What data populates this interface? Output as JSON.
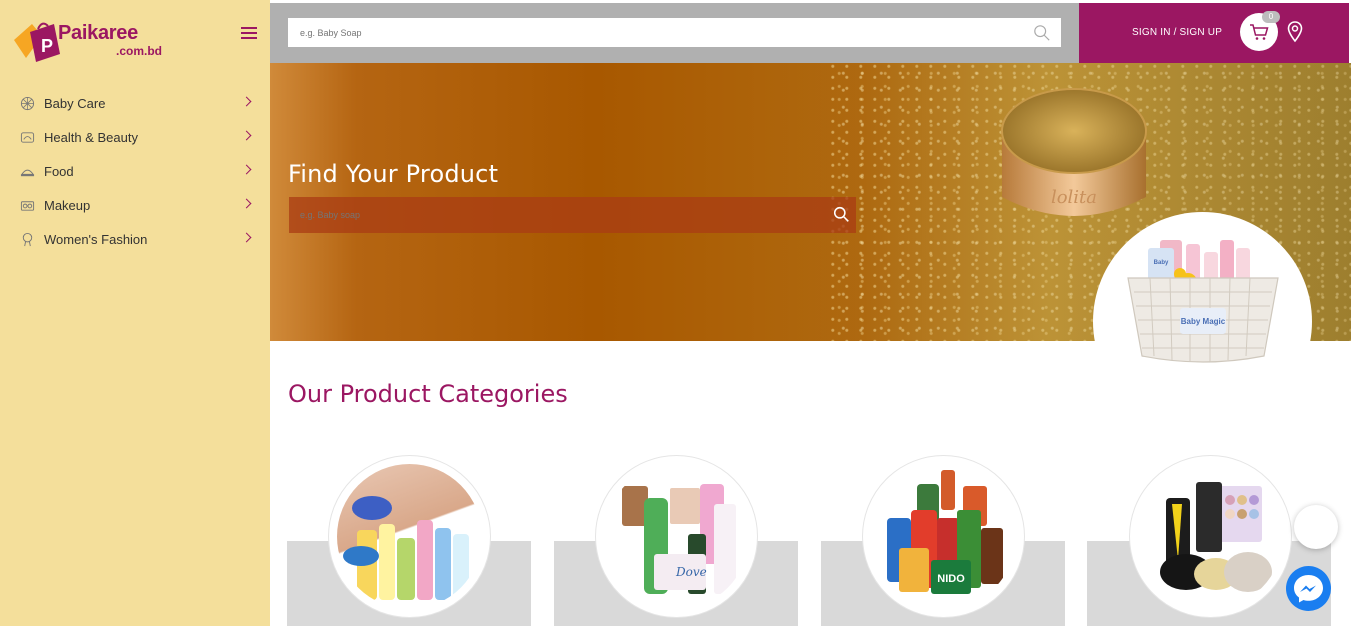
{
  "brand": {
    "name": "Paikaree",
    "domain": ".com.bd",
    "logo_letter": "P",
    "color": "#9b1762"
  },
  "sidebar": {
    "background": "#f4df9b",
    "items": [
      {
        "label": "Baby Care",
        "icon": "baby-care-icon"
      },
      {
        "label": "Health & Beauty",
        "icon": "health-beauty-icon"
      },
      {
        "label": "Food",
        "icon": "food-icon"
      },
      {
        "label": "Makeup",
        "icon": "makeup-icon"
      },
      {
        "label": "Women's Fashion",
        "icon": "fashion-icon"
      }
    ]
  },
  "topbar": {
    "search_placeholder": "e.g. Baby Soap",
    "signin_label": "SIGN IN / SIGN UP",
    "cart_count": "0"
  },
  "hero": {
    "title": "Find Your Product",
    "search_placeholder": "e.g. Baby soap",
    "jar_text": "lolita",
    "basket_brand": "Baby Magic"
  },
  "categories": {
    "title": "Our Product Categories"
  }
}
